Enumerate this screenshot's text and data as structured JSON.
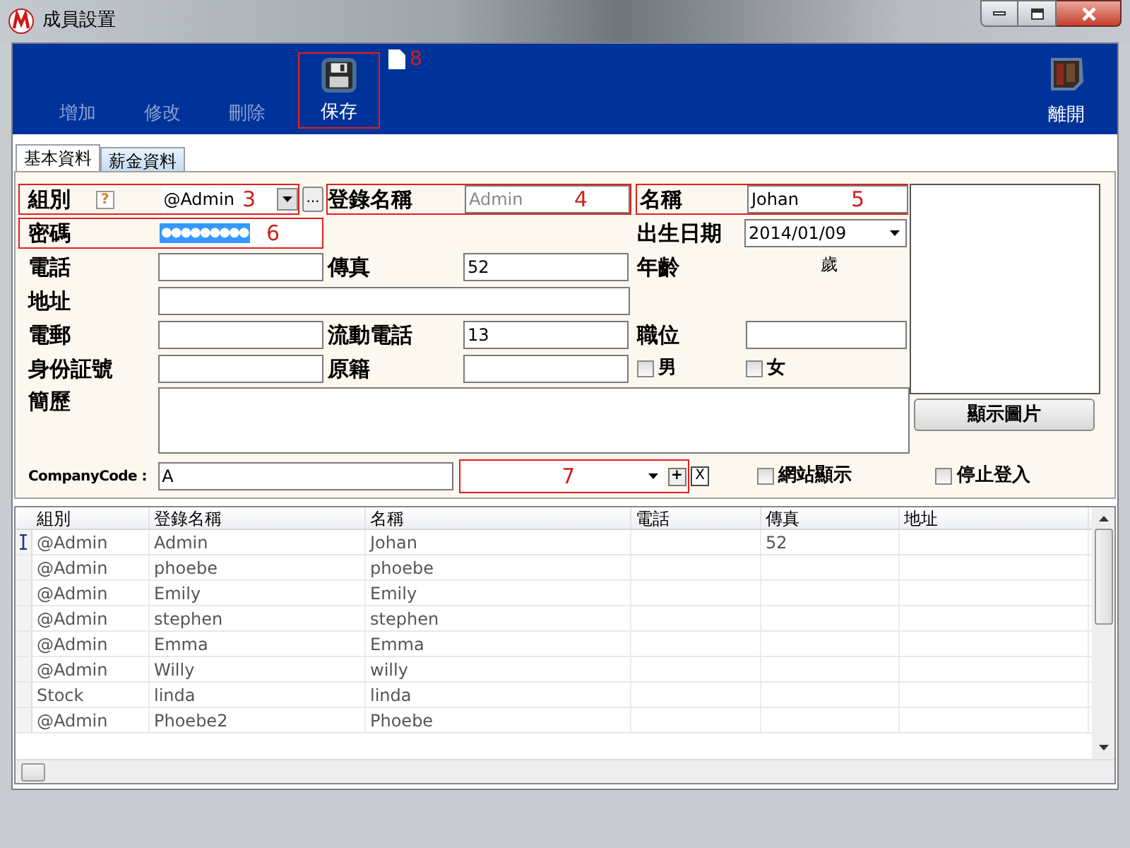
{
  "window": {
    "title": "成員設置"
  },
  "toolbar": {
    "buttons": [
      {
        "label": "增加",
        "disabled": true
      },
      {
        "label": "修改",
        "disabled": true
      },
      {
        "label": "刪除",
        "disabled": true
      },
      {
        "label": "保存",
        "disabled": false,
        "annotation": "8"
      }
    ],
    "exit": {
      "label": "離開"
    }
  },
  "tabs": [
    {
      "label": "基本資料",
      "selected": true
    },
    {
      "label": "薪金資料",
      "selected": false
    }
  ],
  "form": {
    "group": {
      "label": "組別",
      "help": "?",
      "value": "@Admin",
      "annotation": "3",
      "browse": "..."
    },
    "login_name": {
      "label": "登錄名稱",
      "value": "Admin",
      "annotation": "4"
    },
    "name": {
      "label": "名稱",
      "value": "Johan",
      "annotation": "5"
    },
    "password": {
      "label": "密碼",
      "value": "●●●●●●●●●",
      "annotation": "6"
    },
    "birth_date": {
      "label": "出生日期",
      "value": "2014/01/09"
    },
    "phone": {
      "label": "電話"
    },
    "fax": {
      "label": "傳真",
      "value": "52"
    },
    "age": {
      "label": "年齡",
      "unit": "歲"
    },
    "address": {
      "label": "地址"
    },
    "email": {
      "label": "電郵"
    },
    "mobile": {
      "label": "流動電話",
      "value": "13"
    },
    "position": {
      "label": "職位"
    },
    "id_number": {
      "label": "身份証號"
    },
    "native_place": {
      "label": "原籍"
    },
    "gender": [
      {
        "label": "男",
        "checked": false
      },
      {
        "label": "女",
        "checked": false
      }
    ],
    "resume": {
      "label": "簡歷"
    },
    "show_photo_button": "顯示圖片",
    "company_code": {
      "label": "CompanyCode :",
      "value": "A"
    },
    "company_combo": {
      "annotation": "7",
      "add": "+",
      "remove": "X"
    },
    "options": [
      {
        "label": "網站顯示",
        "checked": false
      },
      {
        "label": "停止登入",
        "checked": false
      }
    ]
  },
  "table": {
    "columns": [
      "組別",
      "登錄名稱",
      "名稱",
      "電話",
      "傳真",
      "地址"
    ],
    "rows": [
      {
        "current": true,
        "cells": [
          "@Admin",
          "Admin",
          "Johan",
          "",
          "52",
          ""
        ]
      },
      {
        "current": false,
        "cells": [
          "@Admin",
          "phoebe",
          "phoebe",
          "",
          "",
          ""
        ]
      },
      {
        "current": false,
        "cells": [
          "@Admin",
          "Emily",
          "Emily",
          "",
          "",
          ""
        ]
      },
      {
        "current": false,
        "cells": [
          "@Admin",
          "stephen",
          "stephen",
          "",
          "",
          ""
        ]
      },
      {
        "current": false,
        "cells": [
          "@Admin",
          "Emma",
          "Emma",
          "",
          "",
          ""
        ]
      },
      {
        "current": false,
        "cells": [
          "@Admin",
          "Willy",
          "willy",
          "",
          "",
          ""
        ]
      },
      {
        "current": false,
        "cells": [
          "Stock",
          "linda",
          "linda",
          "",
          "",
          ""
        ]
      },
      {
        "current": false,
        "cells": [
          "@Admin",
          "Phoebe2",
          "Phoebe",
          "",
          "",
          ""
        ]
      }
    ]
  }
}
